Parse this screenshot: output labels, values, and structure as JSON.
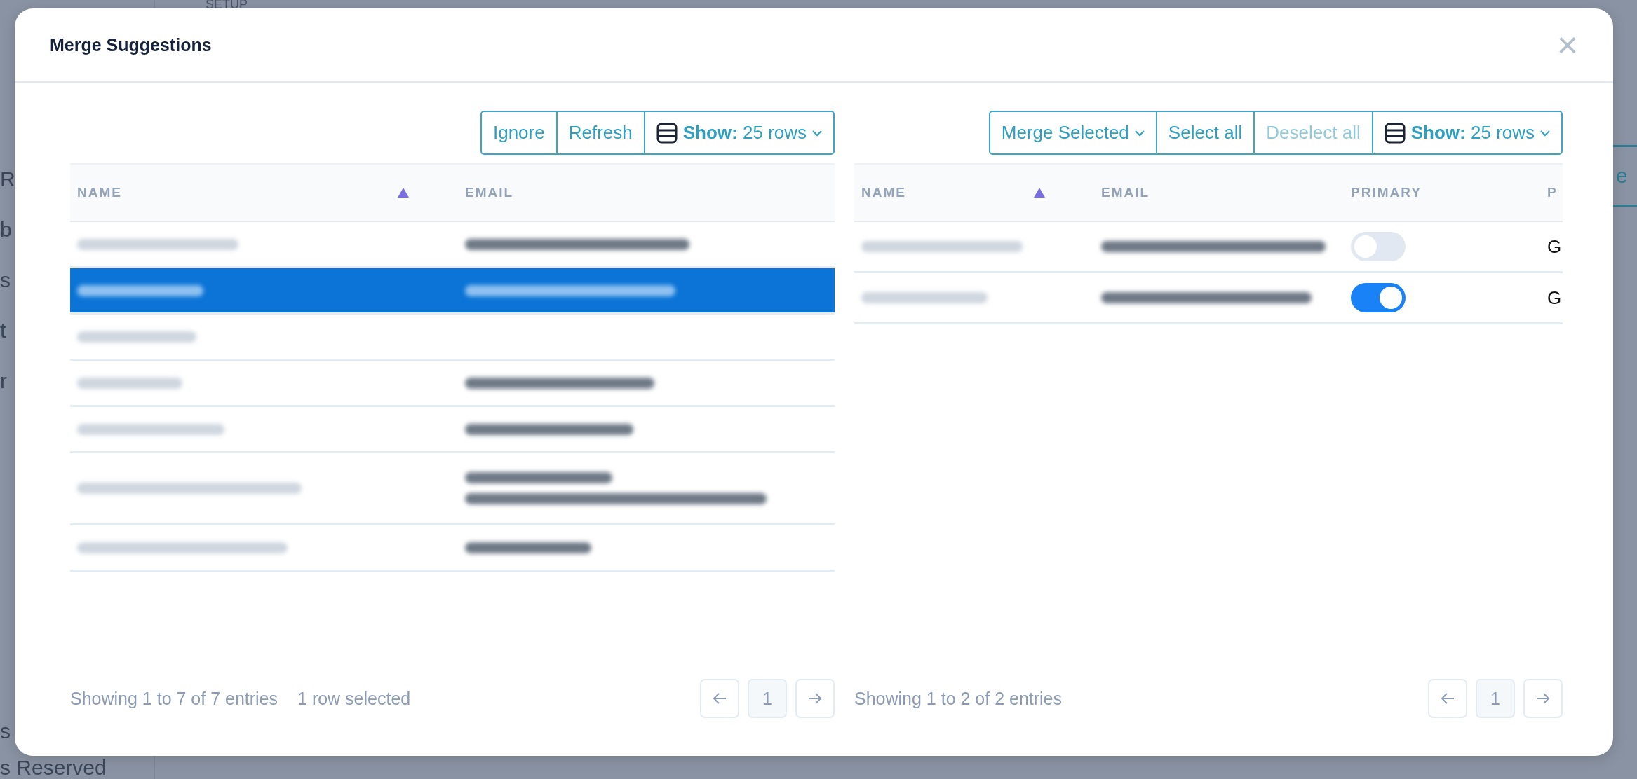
{
  "backdrop": {
    "section": "SETUP",
    "sidebar_items": [
      "R",
      "b",
      "s",
      "t",
      "r"
    ],
    "sidebar_bottom": [
      "s",
      "s Reserved"
    ],
    "action": "e"
  },
  "modal": {
    "title": "Merge Suggestions",
    "close": "×"
  },
  "left_panel": {
    "toolbar": [
      {
        "kind": "button",
        "label": "Ignore",
        "disabled": false
      },
      {
        "kind": "button",
        "label": "Refresh",
        "disabled": false
      },
      {
        "kind": "show",
        "label": "**Show:** 25 rows",
        "disabled": false
      }
    ],
    "columns": [
      {
        "label": "NAME",
        "sorted": true
      },
      {
        "label": "EMAIL",
        "sorted": false
      }
    ],
    "rows": [
      {
        "selected": false,
        "cells": [
          {
            "kind": "blurred"
          },
          {
            "kind": "blurred"
          }
        ]
      },
      {
        "selected": true,
        "cells": [
          {
            "kind": "blurred"
          },
          {
            "kind": "blurred"
          }
        ]
      },
      {
        "selected": false,
        "cells": [
          {
            "kind": "blurred"
          },
          {
            "kind": "empty"
          }
        ]
      },
      {
        "selected": false,
        "cells": [
          {
            "kind": "blurred"
          },
          {
            "kind": "blurred"
          }
        ]
      },
      {
        "selected": false,
        "cells": [
          {
            "kind": "blurred"
          },
          {
            "kind": "blurred"
          }
        ]
      },
      {
        "selected": false,
        "cells": [
          {
            "kind": "blurred"
          },
          {
            "kind": "wrapped"
          }
        ]
      },
      {
        "selected": false,
        "cells": [
          {
            "kind": "blurred"
          },
          {
            "kind": "blurred"
          }
        ]
      }
    ],
    "footer": {
      "info": "Showing 1 to 7 of 7 entries",
      "selection": "1 row selected",
      "page": "1"
    }
  },
  "right_panel": {
    "toolbar": [
      {
        "kind": "dropdown",
        "label": "Merge Selected",
        "disabled": false
      },
      {
        "kind": "button",
        "label": "Select all",
        "disabled": false
      },
      {
        "kind": "button",
        "label": "Deselect all",
        "disabled": true
      },
      {
        "kind": "show",
        "label": "**Show:** 25 rows",
        "disabled": false
      }
    ],
    "columns": [
      {
        "label": "NAME",
        "sorted": true
      },
      {
        "label": "EMAIL",
        "sorted": false
      },
      {
        "label": "PRIMARY",
        "sorted": false
      },
      {
        "label": "P",
        "sorted": false
      }
    ],
    "rows": [
      {
        "selected": false,
        "cells": [
          {
            "kind": "blurred"
          },
          {
            "kind": "blurred"
          },
          {
            "kind": "toggle",
            "on": false
          },
          {
            "kind": "text",
            "text": "G"
          }
        ]
      },
      {
        "selected": false,
        "cells": [
          {
            "kind": "blurred"
          },
          {
            "kind": "blurred"
          },
          {
            "kind": "toggle",
            "on": true
          },
          {
            "kind": "text",
            "text": "G"
          }
        ]
      }
    ],
    "footer": {
      "info": "Showing 1 to 2 of 2 entries",
      "page": "1"
    }
  }
}
